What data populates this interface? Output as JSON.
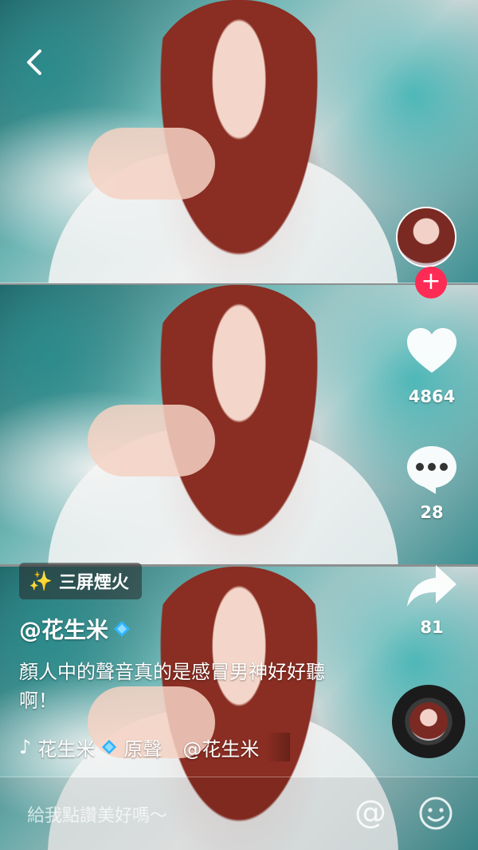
{
  "sidebar": {
    "like_count": "4864",
    "comment_count": "28",
    "share_count": "81"
  },
  "effect_tag": {
    "label": "三屏煙火",
    "icon": "sparkle-wand-icon"
  },
  "author": {
    "handle": "@花生米"
  },
  "caption": {
    "text": "顏人中的聲音真的是感冒男神好好聽啊！"
  },
  "music": {
    "icon": "music-note-icon",
    "artist": "花生米",
    "title": "原聲",
    "credit": "@花生米"
  },
  "comment_bar": {
    "placeholder": "給我點讚美好嗎～",
    "at_symbol": "@"
  },
  "colors": {
    "follow_button": "#fe2c55",
    "verified_badge": "#2fb5ff",
    "tag_icon": "#f6c22c"
  }
}
